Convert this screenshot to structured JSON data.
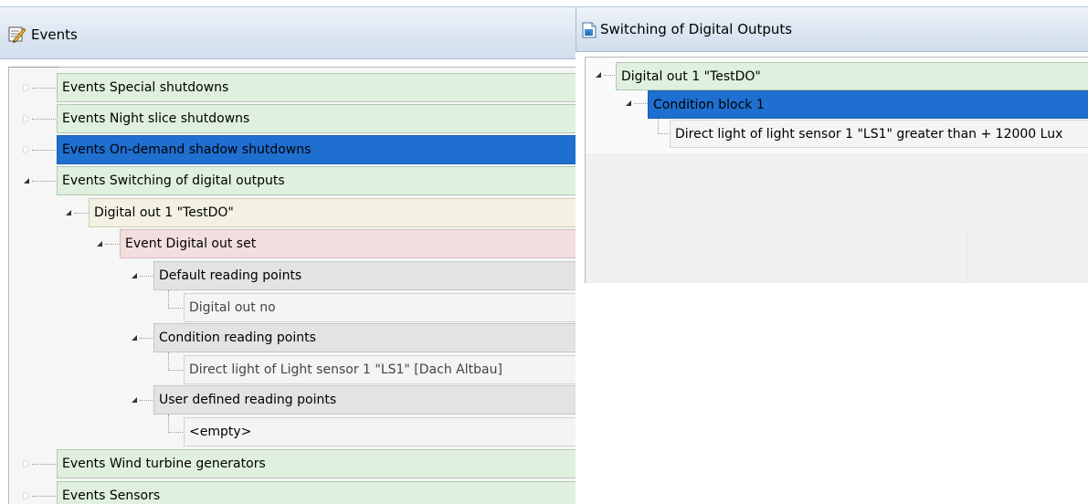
{
  "events_panel": {
    "title": "Events",
    "icon": "events-icon",
    "tree": [
      {
        "label": "Events Special shutdowns",
        "state": "collapsed"
      },
      {
        "label": "Events Night slice shutdowns",
        "state": "collapsed"
      },
      {
        "label": "Events On-demand shadow shutdowns",
        "state": "collapsed",
        "selected": true
      },
      {
        "label": "Events Switching of digital outputs",
        "state": "expanded"
      },
      {
        "label": "Digital out 1 \"TestDO\"",
        "state": "expanded"
      },
      {
        "label": "Event Digital out set",
        "state": "expanded"
      },
      {
        "label": "Default reading points",
        "state": "expanded"
      },
      {
        "label": "Digital out no",
        "state": "leaf"
      },
      {
        "label": "Condition reading points",
        "state": "expanded"
      },
      {
        "label": "Direct light of Light sensor 1 \"LS1\" [Dach Altbau]",
        "state": "leaf"
      },
      {
        "label": "User defined reading points",
        "state": "expanded"
      },
      {
        "label": "<empty>",
        "state": "leaf"
      },
      {
        "label": "Events Wind turbine generators",
        "state": "collapsed"
      },
      {
        "label": "Events Sensors",
        "state": "collapsed"
      }
    ]
  },
  "switching_panel": {
    "title": "Switching of Digital Outputs",
    "icon": "document-icon",
    "tree": [
      {
        "label": "Digital out 1 \"TestDO\"",
        "state": "expanded"
      },
      {
        "label": "Condition block 1",
        "state": "expanded",
        "selected": true
      },
      {
        "label": "Direct light of light sensor 1 \"LS1\" greater than + 12000 Lux",
        "state": "leaf"
      }
    ]
  },
  "colors": {
    "selected": "#1f6fd0",
    "category_row": "#dff0df",
    "output_row": "#f3f2e2",
    "event_row": "#f2dede",
    "group_row": "#e3e3e3",
    "header_bg": "#dce6f2"
  }
}
